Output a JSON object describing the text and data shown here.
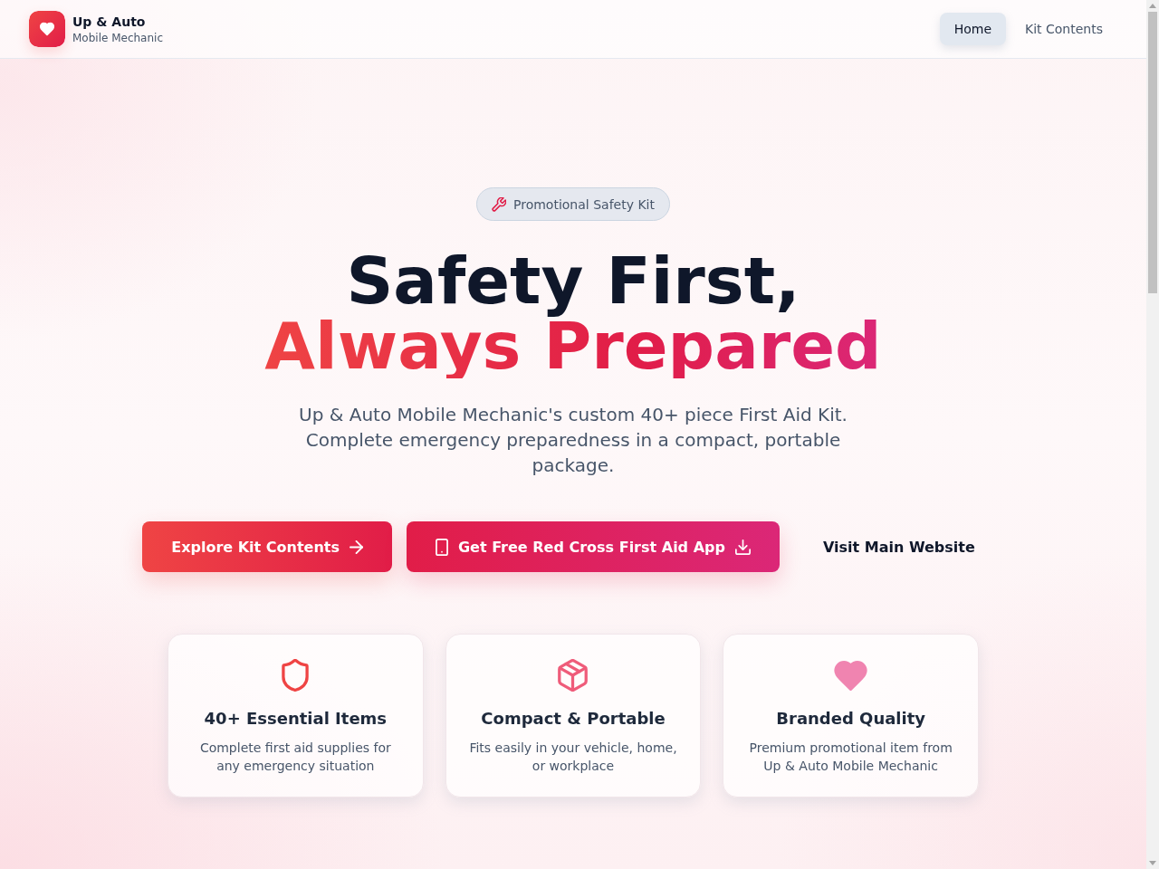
{
  "header": {
    "brand": {
      "name": "Up & Auto",
      "tagline": "Mobile Mechanic"
    },
    "nav": [
      {
        "label": "Home",
        "selected": true
      },
      {
        "label": "Kit Contents",
        "selected": false
      }
    ]
  },
  "hero": {
    "badge": "Promotional Safety Kit",
    "title_line_1": "Safety First,",
    "title_line_2": "Always Prepared",
    "subtitle": "Up & Auto Mobile Mechanic's custom 40+ piece First Aid Kit. Complete emergency preparedness in a compact, portable package.",
    "actions": [
      {
        "label": "Explore Kit Contents",
        "kind": "primary"
      },
      {
        "label": "Get Free Red Cross First Aid App",
        "kind": "app"
      },
      {
        "label": "Visit Main Website",
        "kind": "link"
      }
    ]
  },
  "features": [
    {
      "kind": "shield",
      "title": "40+ Essential Items",
      "text": "Complete first aid supplies for any emergency situation"
    },
    {
      "kind": "package",
      "title": "Compact & Portable",
      "text": "Fits easily in your vehicle, home, or workplace"
    },
    {
      "kind": "heart",
      "title": "Branded Quality",
      "text": "Premium promotional item from Up & Auto Mobile Mechanic"
    }
  ]
}
